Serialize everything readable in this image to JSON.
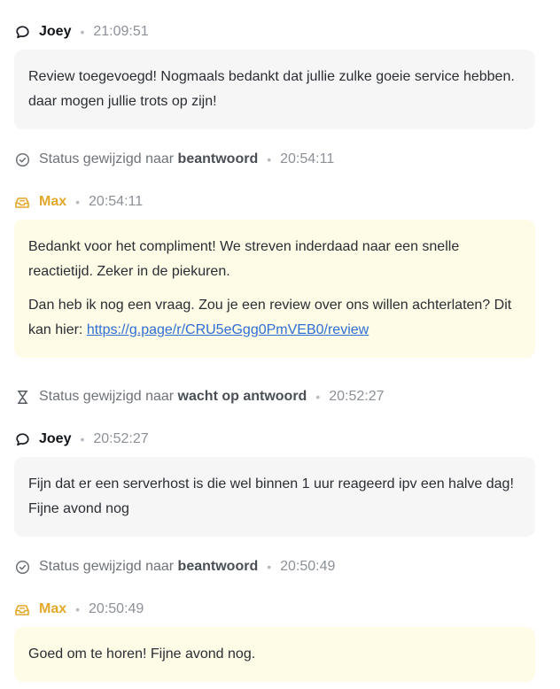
{
  "feed": {
    "items": [
      {
        "type": "message",
        "author": "Joey",
        "time": "21:09:51",
        "icon": "speech-bubble-icon",
        "text": "Review toegevoegd! Nogmaals bedankt dat jullie zulke goeie service hebben. daar mogen jullie trots op zijn!"
      },
      {
        "type": "status",
        "icon": "check-circle-icon",
        "prefix": "Status gewijzigd naar",
        "status": "beantwoord",
        "time": "20:54:11"
      },
      {
        "type": "message",
        "author": "Max",
        "time": "20:54:11",
        "icon": "agent-tray-icon",
        "text1": "Bedankt voor het compliment! We streven inderdaad naar een snelle reactietijd. Zeker in de piekuren.",
        "text2_prefix": "Dan heb ik nog een vraag. Zou je een review over ons willen achterlaten? Dit kan hier:",
        "link": "https://g.page/r/CRU5eGgg0PmVEB0/review"
      },
      {
        "type": "status",
        "icon": "hourglass-icon",
        "prefix": "Status gewijzigd naar",
        "status": "wacht op antwoord",
        "time": "20:52:27"
      },
      {
        "type": "message",
        "author": "Joey",
        "time": "20:52:27",
        "icon": "speech-bubble-icon",
        "text": "Fijn dat er een serverhost is die wel binnen 1 uur reageerd ipv een halve dag! Fijne avond nog"
      },
      {
        "type": "status",
        "icon": "check-circle-icon",
        "prefix": "Status gewijzigd naar",
        "status": "beantwoord",
        "time": "20:50:49"
      },
      {
        "type": "message",
        "author": "Max",
        "time": "20:50:49",
        "icon": "agent-tray-icon",
        "text": "Goed om te horen! Fijne avond nog."
      }
    ],
    "separator": "•"
  },
  "colors": {
    "agent_accent": "#e3a82b",
    "agent_bubble": "#fefbe6",
    "user_bubble": "#f6f6f7",
    "link": "#2f6fd3"
  }
}
